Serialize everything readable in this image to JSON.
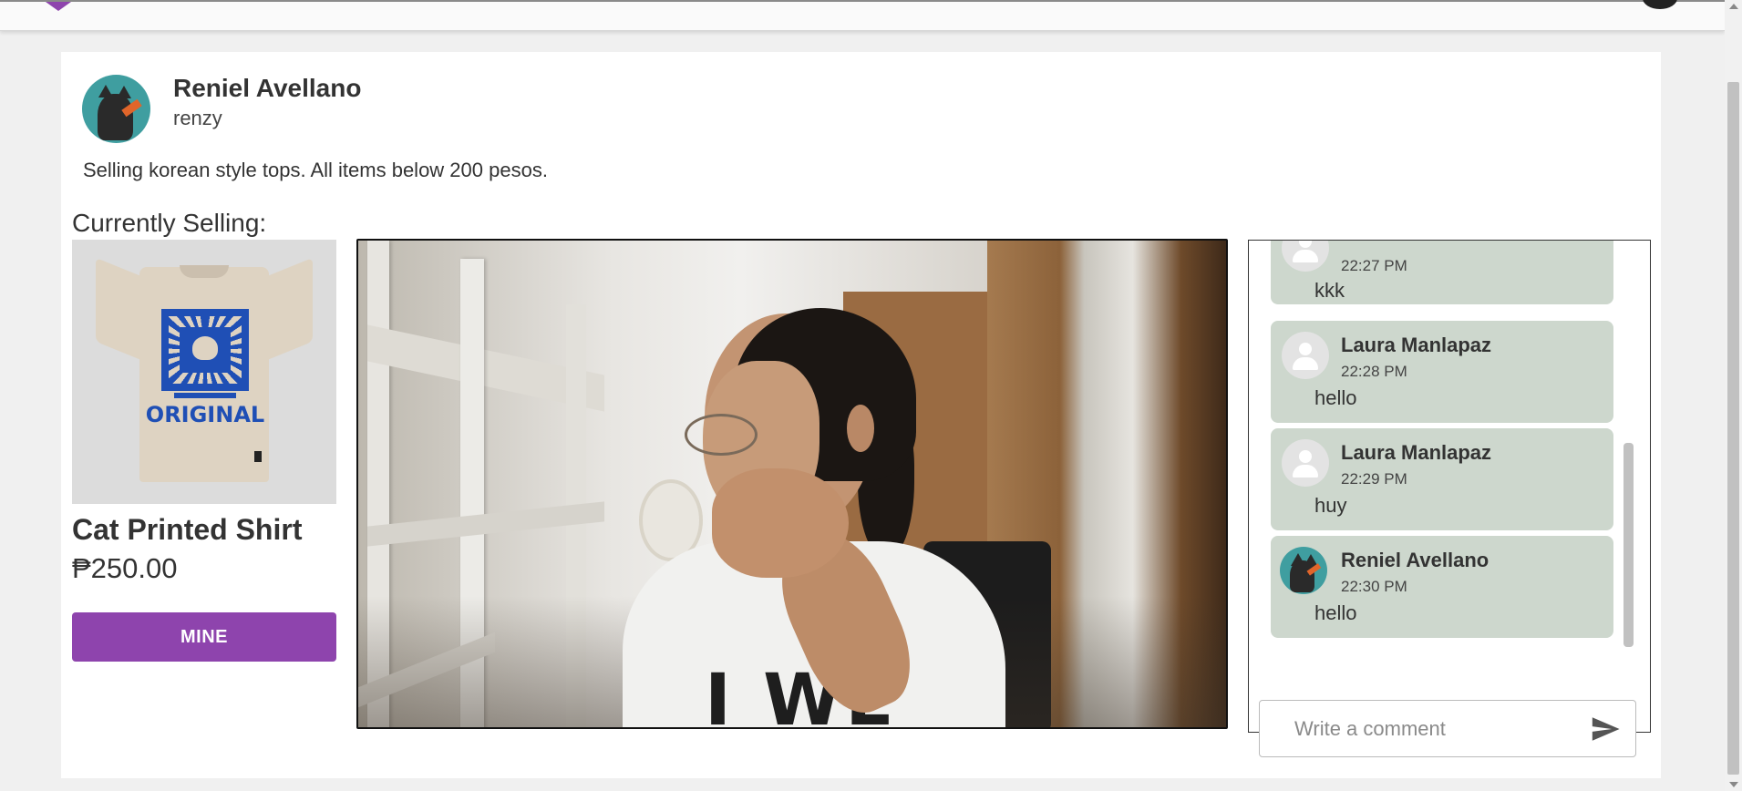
{
  "seller": {
    "name": "Reniel Avellano",
    "username": "renzy",
    "description": "Selling korean style tops. All items below 200 pesos."
  },
  "selling": {
    "section_title": "Currently Selling:",
    "product_name": "Cat Printed Shirt",
    "product_price": "₱250.00",
    "shirt_print_text": "ORIGINAL",
    "mine_label": "MINE"
  },
  "video": {
    "shirt_text": "I WE"
  },
  "comments": [
    {
      "name": "",
      "time": "22:27 PM",
      "text": "kkk",
      "avatar": "person-icon"
    },
    {
      "name": "Laura Manlapaz",
      "time": "22:28 PM",
      "text": "hello",
      "avatar": "person-icon"
    },
    {
      "name": "Laura Manlapaz",
      "time": "22:29 PM",
      "text": "huy",
      "avatar": "person-icon"
    },
    {
      "name": "Reniel Avellano",
      "time": "22:30 PM",
      "text": "hello",
      "avatar": "cat-avatar"
    }
  ],
  "comment_input": {
    "placeholder": "Write a comment"
  },
  "colors": {
    "accent": "#8e44ad",
    "comment_bubble": "#cdd7cd",
    "avatar_bg": "#3f9ea0"
  }
}
